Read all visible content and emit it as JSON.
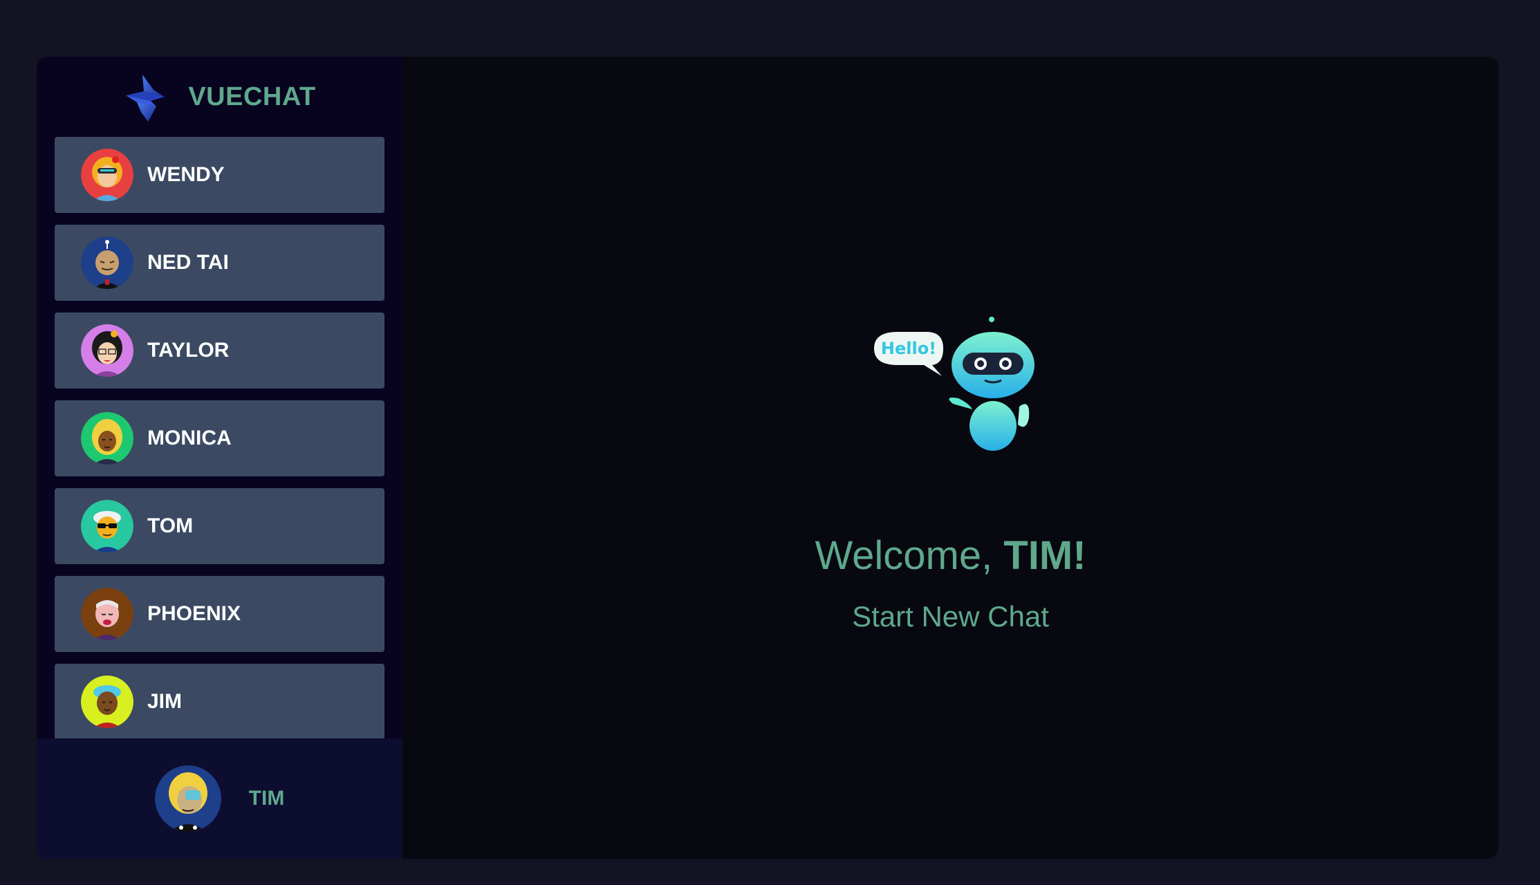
{
  "brand": {
    "name": "VUECHAT"
  },
  "contacts": [
    {
      "name": "WENDY",
      "avatar_bg": "#e84040",
      "hair": "#f2b020"
    },
    {
      "name": "NED TAI",
      "avatar_bg": "#1e3f8a",
      "hair": "#c8a070"
    },
    {
      "name": "TAYLOR",
      "avatar_bg": "#d67ee8",
      "hair": "#1a1a1a"
    },
    {
      "name": "MONICA",
      "avatar_bg": "#1ec870",
      "hair": "#f0d040"
    },
    {
      "name": "TOM",
      "avatar_bg": "#28c8a0",
      "hair": "#f0f0f0"
    },
    {
      "name": "PHOENIX",
      "avatar_bg": "#7a4010",
      "hair": "#e8e8e8"
    },
    {
      "name": "JIM",
      "avatar_bg": "#d8f020",
      "hair": "#50c8e8"
    }
  ],
  "current_user": {
    "name": "TIM",
    "avatar_bg": "#1e3f8a"
  },
  "main": {
    "bubble_text": "Hello!",
    "welcome_prefix": "Welcome, ",
    "welcome_name": "TIM!",
    "subtitle": "Start New Chat"
  },
  "colors": {
    "accent": "#5fa88c",
    "page_bg": "#131324",
    "sidebar_bg": "#080420",
    "contact_bg": "#3b4a62",
    "user_panel_bg": "#0d0d30",
    "main_bg": "#080810"
  }
}
